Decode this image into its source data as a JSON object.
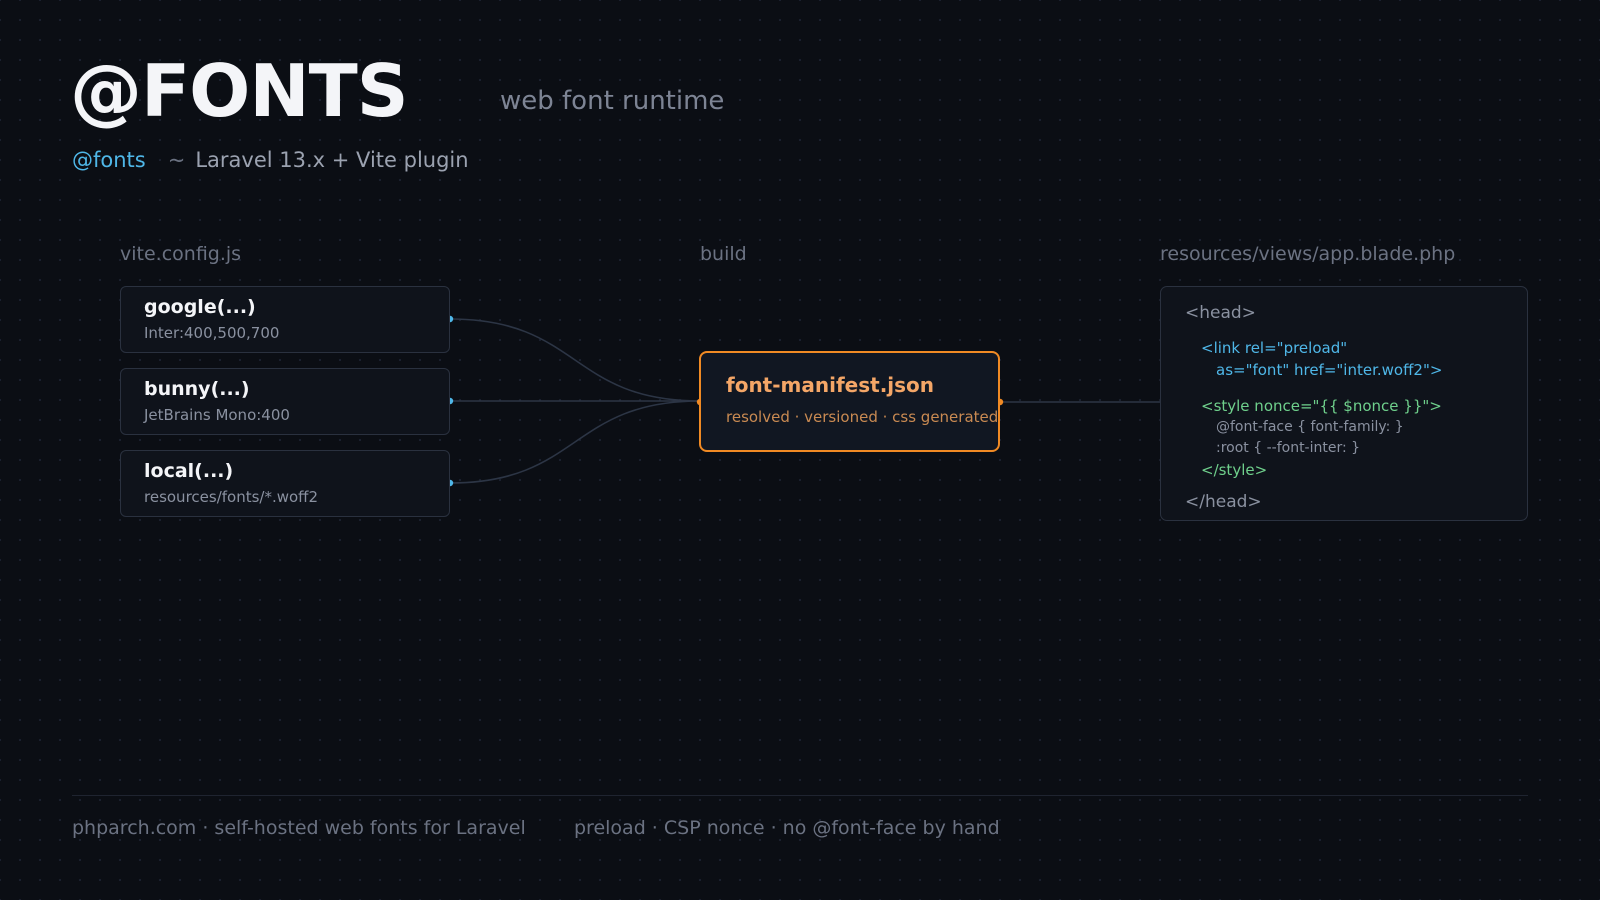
{
  "header": {
    "title": "@FONTS",
    "subtitle": "web font runtime",
    "tag": "@fonts",
    "separator": "~",
    "stack": "Laravel 13.x + Vite plugin"
  },
  "columns": {
    "config": "vite.config.js",
    "build": "build",
    "view": "resources/views/app.blade.php"
  },
  "sources": [
    {
      "title": "google(...)",
      "detail": "Inter:400,500,700"
    },
    {
      "title": "bunny(...)",
      "detail": "JetBrains Mono:400"
    },
    {
      "title": "local(...)",
      "detail": "resources/fonts/*.woff2"
    }
  ],
  "manifest": {
    "title": "font-manifest.json",
    "detail": "resolved · versioned · css generated"
  },
  "code": {
    "head_open": "<head>",
    "link_line1": "<link rel=\"preload\"",
    "link_line2": "as=\"font\" href=\"inter.woff2\">",
    "style_open": "<style nonce=\"{{ $nonce }}\">",
    "fontface": "@font-face { font-family: }",
    "root": ":root { --font-inter: }",
    "style_close": "</style>",
    "head_close": "</head>"
  },
  "footer": {
    "left": "phparch.com · self-hosted web fonts for Laravel",
    "right": "preload · CSP nonce · no @font-face by hand"
  },
  "colors": {
    "accent_blue": "#4fb7e8",
    "accent_orange": "#f08a24",
    "code_green": "#6fd08c",
    "wire": "#2c3545"
  }
}
